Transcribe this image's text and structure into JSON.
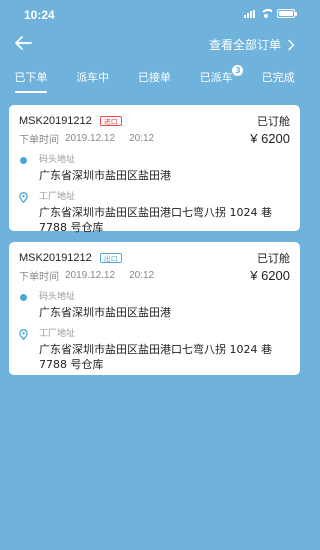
{
  "statusbar": {
    "time": "10:24"
  },
  "nav": {
    "view_all": "查看全部订单"
  },
  "tabs": [
    {
      "label": "已下单",
      "active": true
    },
    {
      "label": "派车中"
    },
    {
      "label": "已接单"
    },
    {
      "label": "已派车",
      "badge": "3"
    },
    {
      "label": "已完成"
    }
  ],
  "orders": [
    {
      "order_no": "MSK20191212",
      "tag": "进口",
      "status": "已订舱",
      "time_label": "下单时间",
      "date": "2019.12.12",
      "time": "20:12",
      "amount": "¥ 6200",
      "dock_label": "码头地址",
      "dock_address": "广东省深圳市盐田区盐田港",
      "factory_label": "工厂地址",
      "factory_address": "广东省深圳市盐田区盐田港口七弯八拐 1024 巷 7788 号仓库"
    },
    {
      "order_no": "MSK20191212",
      "tag": "出口",
      "status": "已订舱",
      "time_label": "下单时间",
      "date": "2019.12.12",
      "time": "20:12",
      "amount": "¥ 6200",
      "dock_label": "码头地址",
      "dock_address": "广东省深圳市盐田区盐田港",
      "factory_label": "工厂地址",
      "factory_address": "广东省深圳市盐田区盐田港口七弯八拐 1024 巷 7788 号仓库"
    }
  ],
  "colors": {
    "background": "#6fb3dc",
    "import_tag": "#e94b4b",
    "export_tag": "#5aaad9",
    "accent": "#4aa6d8"
  }
}
